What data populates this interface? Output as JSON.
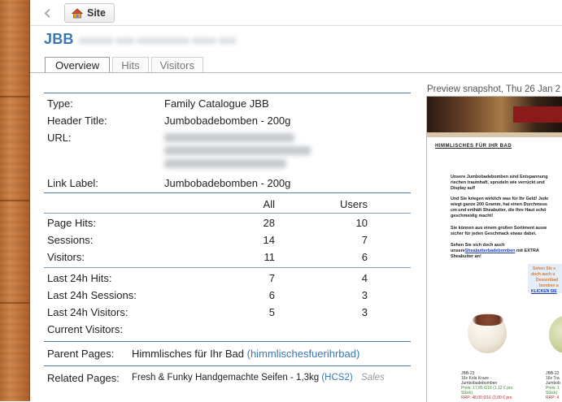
{
  "toolbar": {
    "back_icon": "chevron-left-icon",
    "site_icon": "house-icon",
    "site_label": "Site"
  },
  "page": {
    "title": "JBB"
  },
  "tabs": [
    {
      "label": "Overview",
      "active": true
    },
    {
      "label": "Hits",
      "active": false
    },
    {
      "label": "Visitors",
      "active": false
    }
  ],
  "details": {
    "type_label": "Type:",
    "type_value": "Family Catalogue JBB",
    "header_title_label": "Header Title:",
    "header_title_value": "Jumbobadebomben - 200g",
    "url_label": "URL:",
    "link_label_label": "Link Label:",
    "link_label_value": "Jumbobadebomben - 200g"
  },
  "stats": {
    "col_all": "All",
    "col_users": "Users",
    "rows": [
      {
        "label": "Page Hits:",
        "all": "28",
        "users": "10"
      },
      {
        "label": "Sessions:",
        "all": "14",
        "users": "7"
      },
      {
        "label": "Visitors:",
        "all": "11",
        "users": "6"
      }
    ],
    "last24": [
      {
        "label": "Last 24h Hits:",
        "all": "7",
        "users": "4"
      },
      {
        "label": "Last 24h Sessions:",
        "all": "6",
        "users": "3"
      },
      {
        "label": "Last 24h Visitors:",
        "all": "5",
        "users": "3"
      },
      {
        "label": "Current Visitors:",
        "all": "",
        "users": ""
      }
    ]
  },
  "parent": {
    "label": "Parent Pages:",
    "name": "Himmlisches für Ihr Bad",
    "slug": "(himmlischesfuerihrbad)"
  },
  "related": {
    "label": "Related Pages:",
    "name": "Fresh & Funky Handgemachte Seifen - 1,3kg",
    "code": "(HCS2)",
    "tag": "Sales"
  },
  "preview": {
    "label": "Preview snapshot, Thu 26 Jan 2",
    "heading": "HIMMLISCHES FÜR IHR BAD",
    "para1": [
      "Unsere Jumbobadebomben sind Entspannung",
      "riechen traumhaft, sprudeln wie verrückt und",
      "Display auf!"
    ],
    "para2": [
      "Und Sie kriegen wirklich was für Ihr Geld! Jede",
      "wiegt ganze 200 Gramm, hat einen Durchmess",
      "cm und enthält Sheabutter, die Ihre Haut schö",
      "geschmeidig macht!"
    ],
    "para3": [
      "Sie können aus einem großen Sortiment ausw",
      "sicher für jeden Geschmack etwas dabei."
    ],
    "para4_a": "Sehen Sie sich doch auch",
    "para4_b": "unsere",
    "para4_link": "Sheabutterbadebomben",
    "para4_c": "mit EXTRA",
    "para4_d": "Sheabutter an!",
    "box_lines": [
      "Sehen Sie s",
      "doch auch u",
      "Dessertbad",
      "bomben a",
      "KLICKEN SIE"
    ],
    "product1": {
      "code": "JBB-23",
      "name1": "16x Kola Kraze -",
      "name2": "Jumbobadebomben",
      "price": "Preis: 17,95 €/16 (1,12 € pro",
      "unit": "Stück)",
      "rrp": "RRP: 48,00 €/16 (3,00 € pro"
    },
    "product2": {
      "code": "JBB-22",
      "name1": "16x Tra",
      "name2": "Jumbob",
      "price": "Preis: 1",
      "unit": "Stück)",
      "rrp": "RRP: 4"
    }
  }
}
